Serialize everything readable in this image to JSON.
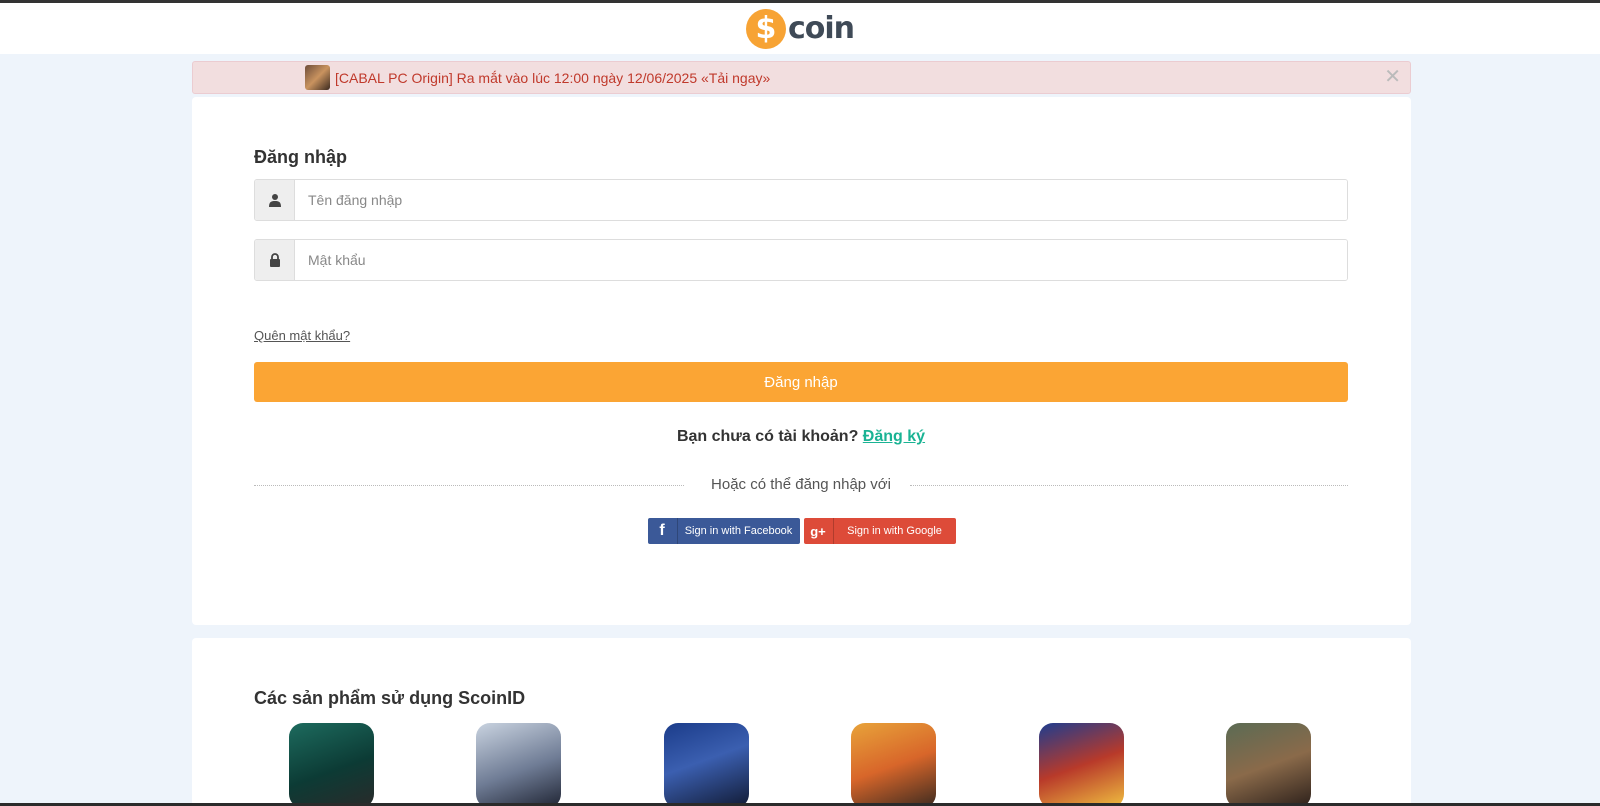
{
  "header": {
    "logo_symbol": "$",
    "logo_text": "coin"
  },
  "banner": {
    "text": "[CABAL PC Origin] Ra mắt vào lúc 12:00 ngày 12/06/2025 «Tải ngay»",
    "close_symbol": "✕"
  },
  "login": {
    "title": "Đăng nhập",
    "username_placeholder": "Tên đăng nhập",
    "password_placeholder": "Mật khẩu",
    "forgot_label": "Quên mật khẩu?",
    "submit_label": "Đăng nhập",
    "no_account_text": "Bạn chưa có tài khoản?",
    "register_label": "Đăng ký",
    "divider_text": "Hoặc có thể đăng nhập với",
    "facebook_label": "Sign in with Facebook",
    "google_label": "Sign in with Google"
  },
  "products": {
    "title": "Các sản phẩm sử dụng ScoinID",
    "items": [
      {
        "icon": "game-icon-1"
      },
      {
        "icon": "game-icon-2"
      },
      {
        "icon": "game-icon-3"
      },
      {
        "icon": "game-icon-4"
      },
      {
        "icon": "game-icon-5"
      },
      {
        "icon": "game-icon-6"
      }
    ]
  },
  "colors": {
    "accent": "#fba534",
    "register_link": "#1ab394",
    "banner_text": "#c0392b",
    "facebook": "#3b5998",
    "google": "#dd4b39"
  }
}
